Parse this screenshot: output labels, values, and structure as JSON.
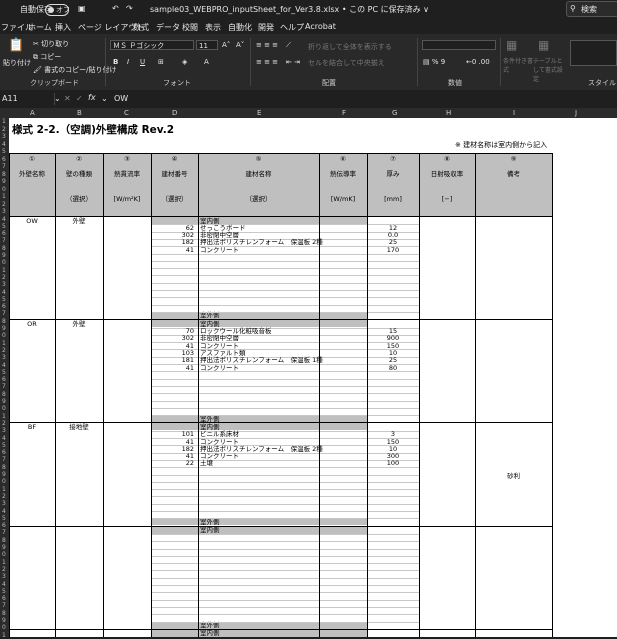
{
  "titlebar": {
    "autosave_label": "自動保存",
    "autosave_state": "オフ",
    "filename": "sample03_WEBPRO_inputSheet_for_Ver3.8.xlsx • この PC に保存済み ∨",
    "search_placeholder": "検索"
  },
  "menu": [
    "ファイル",
    "ホーム",
    "挿入",
    "ページ レイアウト",
    "数式",
    "データ",
    "校閲",
    "表示",
    "自動化",
    "開発",
    "ヘルプ",
    "Acrobat"
  ],
  "ribbon": {
    "paste": "貼り付け",
    "cut": "切り取り",
    "copy": "コピー",
    "format_painter": "書式のコピー/貼り付け",
    "clipboard": "クリップボード",
    "font_name": "ＭＳ Ｐゴシック",
    "font_size": "11",
    "font_group": "フォント",
    "wrap": "折り返して全体を表示する",
    "merge": "セルを結合して中央揃え",
    "align_group": "配置",
    "number_group": "数値",
    "cond_format": "条件付き書式",
    "table_format": "テーブルとして書式設定",
    "style_group": "スタイル"
  },
  "formula_bar": {
    "name_box": "A11",
    "value": "OW"
  },
  "columns": [
    "A",
    "B",
    "C",
    "D",
    "E",
    "F",
    "G",
    "H",
    "I",
    "J"
  ],
  "rows": [
    "1",
    "2",
    "3",
    "4",
    "5",
    "6",
    "7",
    "8",
    "9",
    "0",
    "1",
    "2",
    "3",
    "4",
    "5",
    "6",
    "7",
    "8",
    "9",
    "0",
    "1",
    "2",
    "3",
    "4",
    "5",
    "6",
    "7",
    "8",
    "9",
    "0",
    "1",
    "2",
    "3",
    "4",
    "5",
    "6",
    "7",
    "8",
    "9",
    "0",
    "1",
    "2",
    "3",
    "4",
    "5",
    "6",
    "7",
    "8",
    "9",
    "0",
    "1",
    "2",
    "3",
    "4",
    "5",
    "6",
    "7",
    "8",
    "9",
    "0",
    "1",
    "2",
    "3",
    "4",
    "5",
    "6",
    "7",
    "8",
    "9",
    "0",
    "1"
  ],
  "sheet": {
    "title": "様式 2-2.（空調)外壁構成 Rev.2",
    "note": "※ 建材名称は室内側から記入",
    "headers": [
      {
        "num": "①",
        "label": "外壁名称",
        "sub": ""
      },
      {
        "num": "②",
        "label": "壁の種類",
        "sub": "（選択）"
      },
      {
        "num": "③",
        "label": "熱貫流率",
        "sub": "[W/m²K]"
      },
      {
        "num": "④",
        "label": "建材番号",
        "sub": "（選択）"
      },
      {
        "num": "⑤",
        "label": "建材名称",
        "sub": "（選択）"
      },
      {
        "num": "⑥",
        "label": "熱伝導率",
        "sub": "[W/mK]"
      },
      {
        "num": "⑦",
        "label": "厚み",
        "sub": "[mm]"
      },
      {
        "num": "⑧",
        "label": "日射吸収率",
        "sub": "[−]"
      },
      {
        "num": "⑨",
        "label": "備考",
        "sub": ""
      }
    ],
    "inside": "室内側",
    "outside": "室外側",
    "blocks": [
      {
        "name": "OW",
        "type": "外壁",
        "remark": "",
        "layers": [
          [
            "62",
            "せっこうボード",
            "12"
          ],
          [
            "302",
            "非密閉中空層",
            "0.0"
          ],
          [
            "182",
            "押出法ポリスチレンフォーム　保温板 2種",
            "25"
          ],
          [
            "41",
            "コンクリート",
            "170"
          ]
        ]
      },
      {
        "name": "OR",
        "type": "外壁",
        "remark": "",
        "layers": [
          [
            "70",
            "ロックウール化粧吸音板",
            "15"
          ],
          [
            "302",
            "非密閉中空層",
            "900"
          ],
          [
            "41",
            "コンクリート",
            "150"
          ],
          [
            "103",
            "アスファルト類",
            "10"
          ],
          [
            "181",
            "押出法ポリスチレンフォーム　保温板 1種",
            "25"
          ],
          [
            "41",
            "コンクリート",
            "80"
          ]
        ]
      },
      {
        "name": "BF",
        "type": "接地壁",
        "remark": "砂利",
        "layers": [
          [
            "101",
            "ビニル系床材",
            "3"
          ],
          [
            "41",
            "コンクリート",
            "150"
          ],
          [
            "182",
            "押出法ポリスチレンフォーム　保温板 2種",
            "10"
          ],
          [
            "41",
            "コンクリート",
            "300"
          ],
          [
            "22",
            "土壌",
            "100"
          ]
        ]
      },
      {
        "name": "",
        "type": "",
        "remark": "",
        "layers": []
      }
    ]
  }
}
